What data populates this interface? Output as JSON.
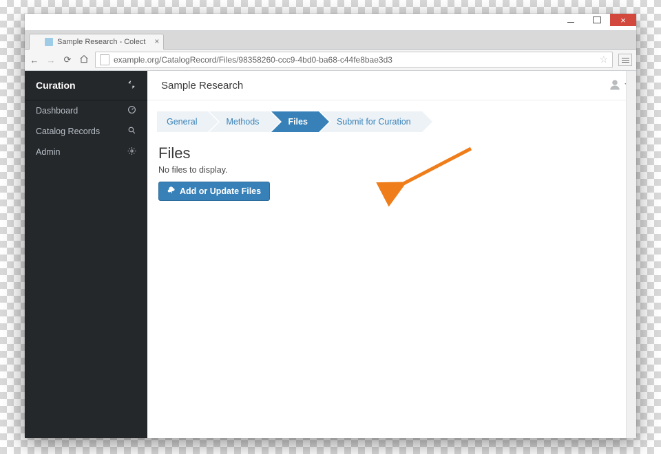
{
  "browser": {
    "tab_title": "Sample Research - Colect",
    "url": "example.org/CatalogRecord/Files/98358260-ccc9-4bd0-ba68-c44fe8bae3d3"
  },
  "sidebar": {
    "title": "Curation",
    "items": [
      {
        "label": "Dashboard"
      },
      {
        "label": "Catalog Records"
      },
      {
        "label": "Admin"
      }
    ]
  },
  "header": {
    "page_title": "Sample Research"
  },
  "wizard": {
    "steps": [
      {
        "label": "General"
      },
      {
        "label": "Methods"
      },
      {
        "label": "Files"
      },
      {
        "label": "Submit for Curation"
      }
    ],
    "active_index": 2
  },
  "files": {
    "heading": "Files",
    "empty_text": "No files to display.",
    "add_button": "Add or Update Files"
  }
}
